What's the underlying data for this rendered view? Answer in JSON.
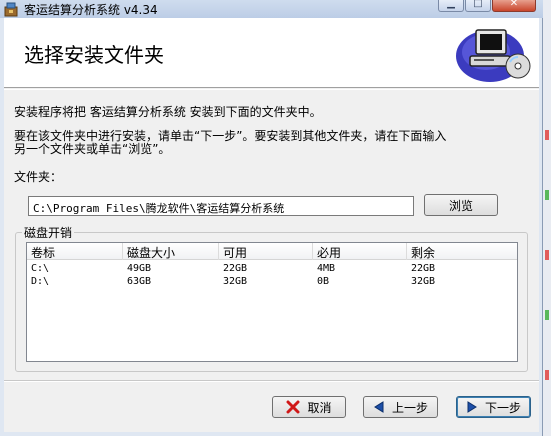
{
  "window": {
    "title": "客运结算分析系统 v4.34"
  },
  "header": {
    "title": "选择安装文件夹"
  },
  "body": {
    "intro": "安装程序将把 客运结算分析系统 安装到下面的文件夹中。",
    "instruction_line1": "要在该文件夹中进行安装，请单击“下一步”。要安装到其他文件夹，请在下面输入",
    "instruction_line2": "另一个文件夹或单击“浏览”。"
  },
  "folder": {
    "label": "文件夹：",
    "path": "C:\\Program Files\\腾龙软件\\客运结算分析系统",
    "browse_label": "浏览"
  },
  "disk_usage": {
    "label": "磁盘开销",
    "columns": [
      "卷标",
      "磁盘大小",
      "可用",
      "必用",
      "剩余"
    ],
    "rows": [
      [
        "C:\\",
        "49GB",
        "22GB",
        "4MB",
        "22GB"
      ],
      [
        "D:\\",
        "63GB",
        "32GB",
        "0B",
        "32GB"
      ]
    ]
  },
  "buttons": {
    "cancel": "取消",
    "back": "上一步",
    "next": "下一步"
  },
  "icons": {
    "cancel": "red-x-icon",
    "back": "left-arrow-icon",
    "next": "right-arrow-icon",
    "header_art": "computer-with-disc-icon"
  }
}
